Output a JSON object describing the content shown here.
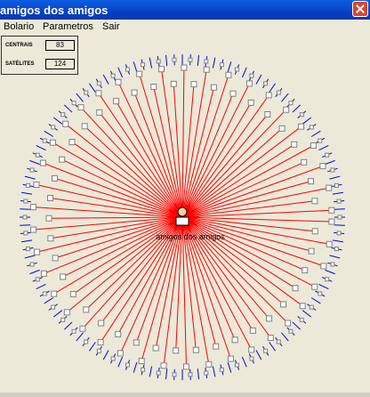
{
  "window": {
    "title": "amigos dos amigos"
  },
  "menu": {
    "items": [
      "Bolario",
      "Parametros",
      "Sair"
    ]
  },
  "stats": {
    "centrais_label": "CENTRAIS",
    "centrais_value": "83",
    "satelites_label": "SATÉLITES",
    "satelites_value": "124"
  },
  "graph": {
    "center_label": "amigos dos amigos",
    "colors": {
      "central_link": "#ff0000",
      "satellite_link": "#0000ff",
      "node_fill": "#ffffff",
      "node_shadow": "#808080",
      "center_burst": "#ff0000"
    }
  }
}
